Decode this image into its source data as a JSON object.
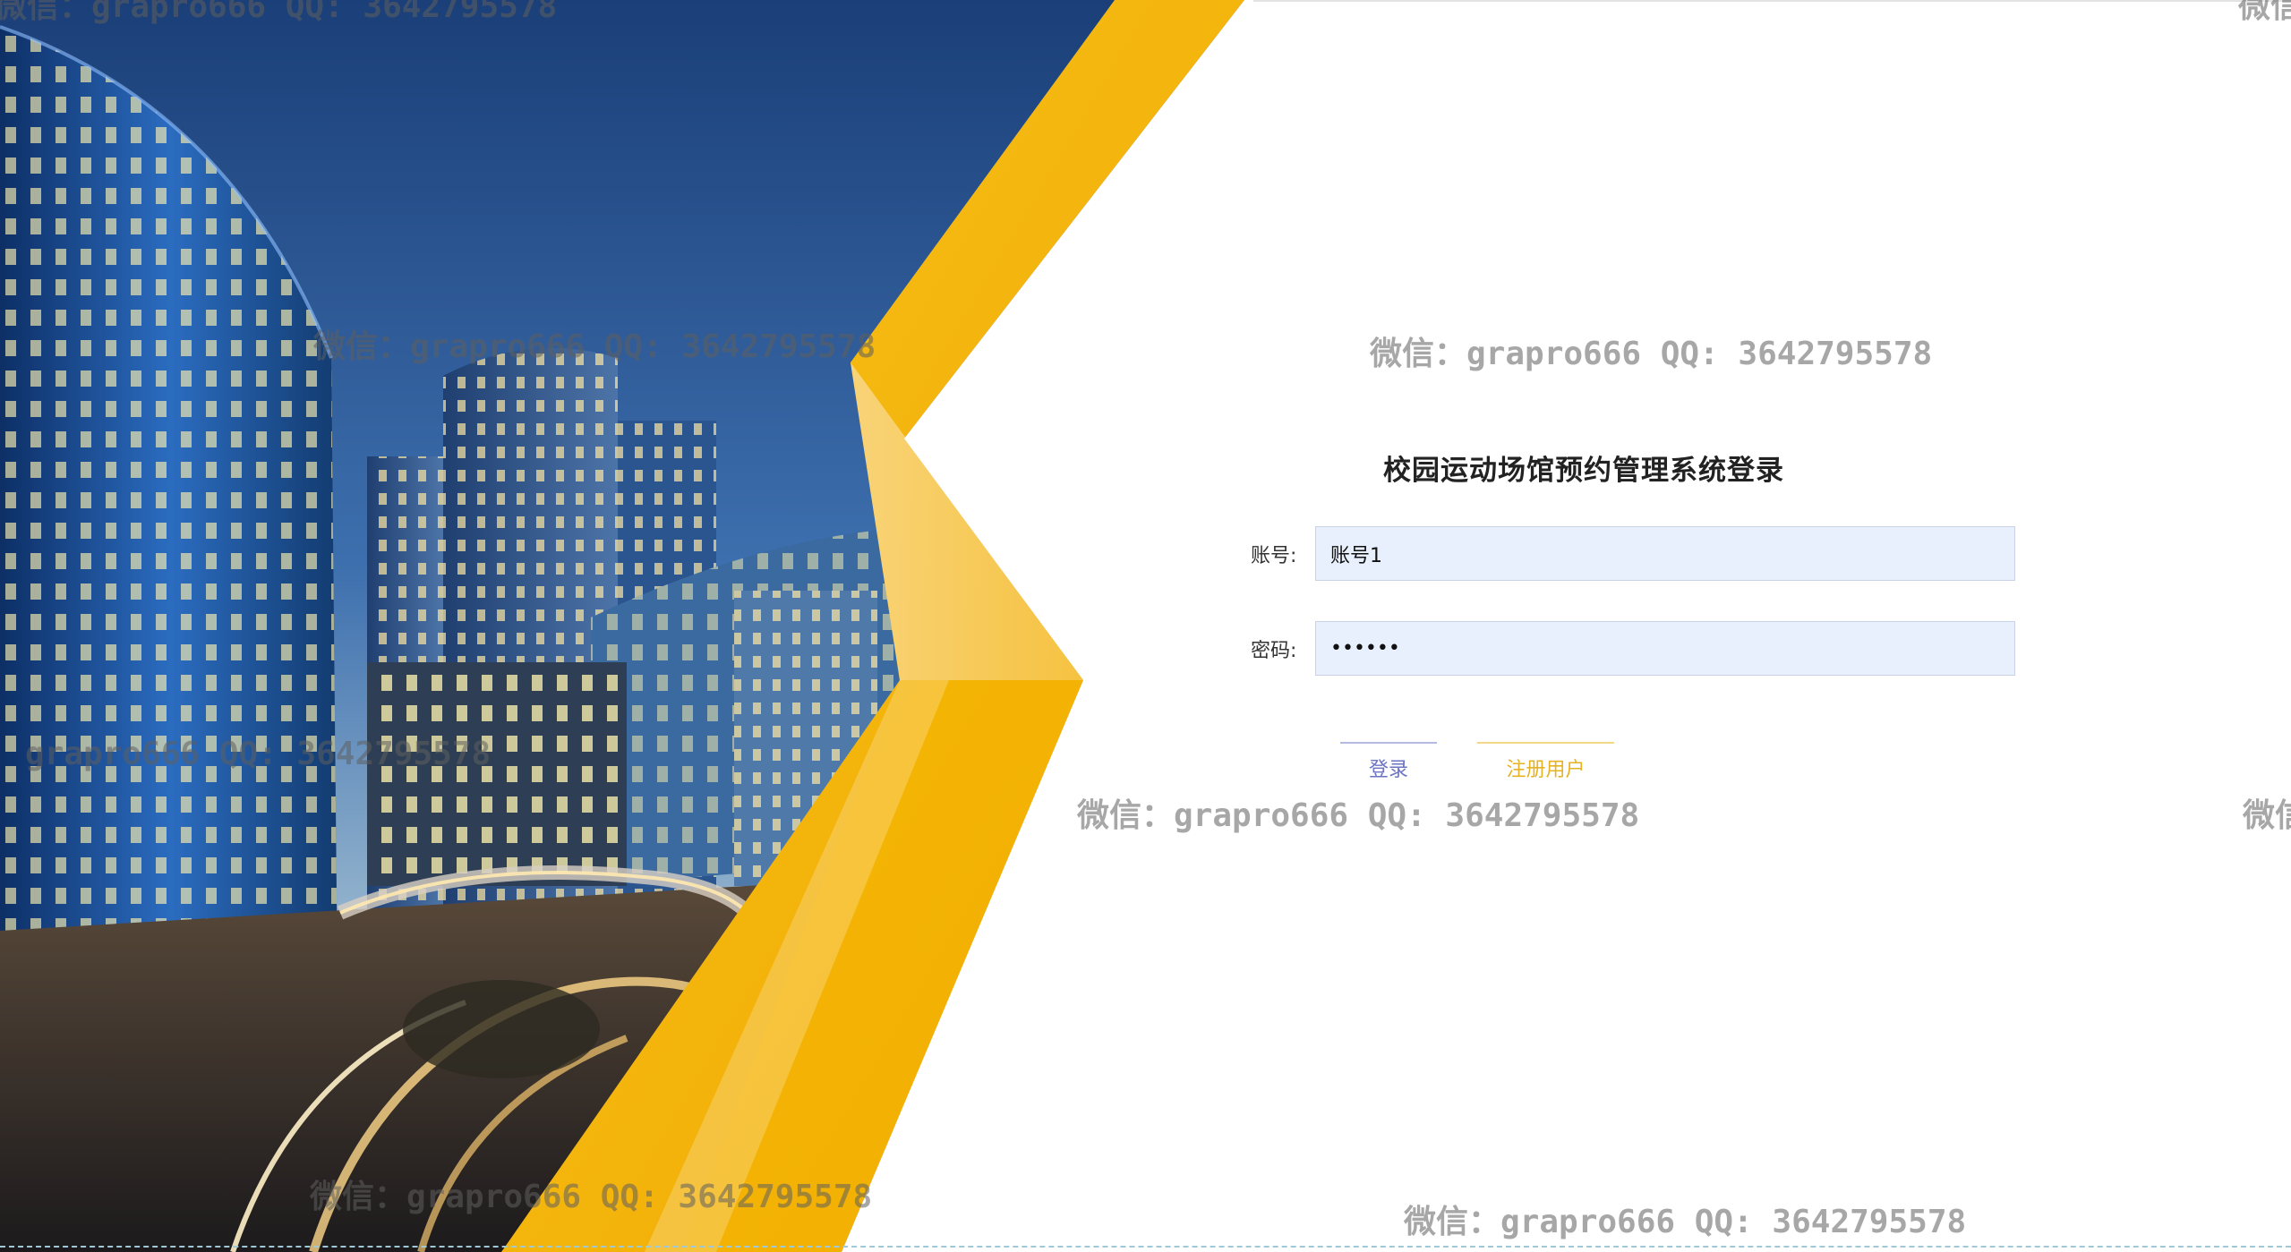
{
  "login": {
    "title": "校园运动场馆预约管理系统登录",
    "account_label": "账号:",
    "account_value": "账号1",
    "password_label": "密码:",
    "password_value": "••••••",
    "login_button": "登录",
    "register_button": "注册用户"
  },
  "watermarks": {
    "full": "微信：grapro666 QQ: 3642795578",
    "partial_left": "grapro666 QQ: 3642795578",
    "partial_right": "微信"
  },
  "colors": {
    "accent_yellow": "#f5b800",
    "input_background": "#e8f0fe",
    "login_button_text": "#6b73c4",
    "register_button_text": "#e5b325"
  }
}
